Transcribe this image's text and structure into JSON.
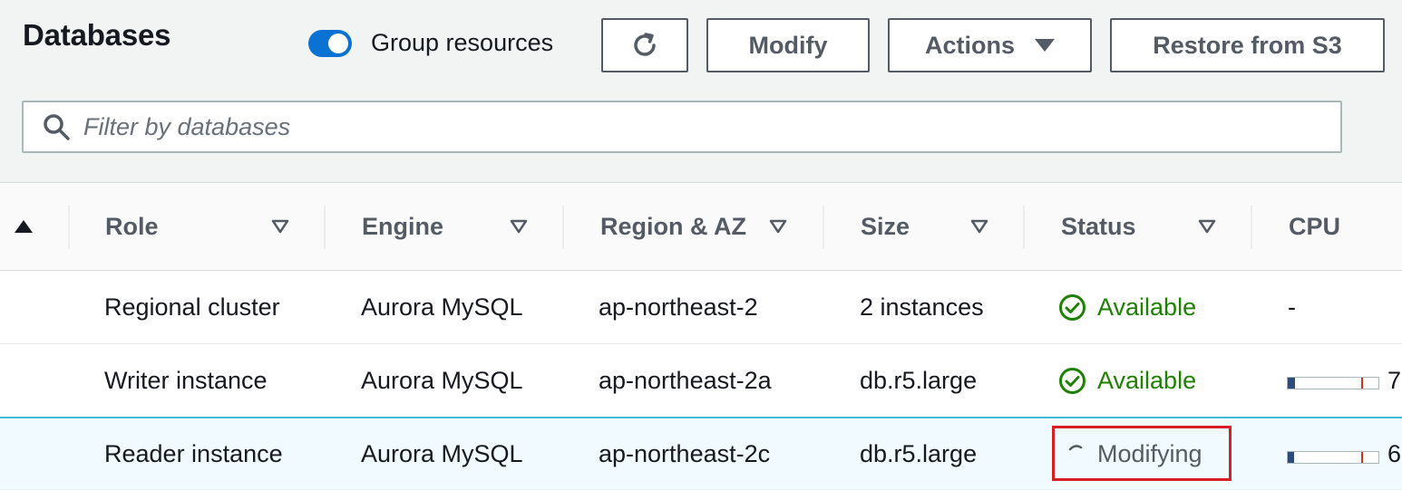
{
  "header": {
    "title": "Databases",
    "group_toggle_label": "Group resources",
    "group_toggle_on": true,
    "refresh_icon": "refresh-icon",
    "modify_label": "Modify",
    "actions_label": "Actions",
    "restore_label": "Restore from S3"
  },
  "search": {
    "placeholder": "Filter by databases",
    "value": ""
  },
  "table": {
    "columns": [
      "Role",
      "Engine",
      "Region & AZ",
      "Size",
      "Status",
      "CPU"
    ],
    "rows": [
      {
        "role": "Regional cluster",
        "engine": "Aurora MySQL",
        "region": "ap-northeast-2",
        "size": "2 instances",
        "status": "Available",
        "cpu": "-"
      },
      {
        "role": "Writer instance",
        "engine": "Aurora MySQL",
        "region": "ap-northeast-2a",
        "size": "db.r5.large",
        "status": "Available",
        "cpu": "7",
        "cpu_level": 0.08
      },
      {
        "role": "Reader instance",
        "engine": "Aurora MySQL",
        "region": "ap-northeast-2c",
        "size": "db.r5.large",
        "status": "Modifying",
        "cpu": "6",
        "cpu_level": 0.07
      }
    ]
  },
  "colors": {
    "accent": "#0972d3",
    "available": "#1d8102",
    "highlight": "#d91f26"
  }
}
